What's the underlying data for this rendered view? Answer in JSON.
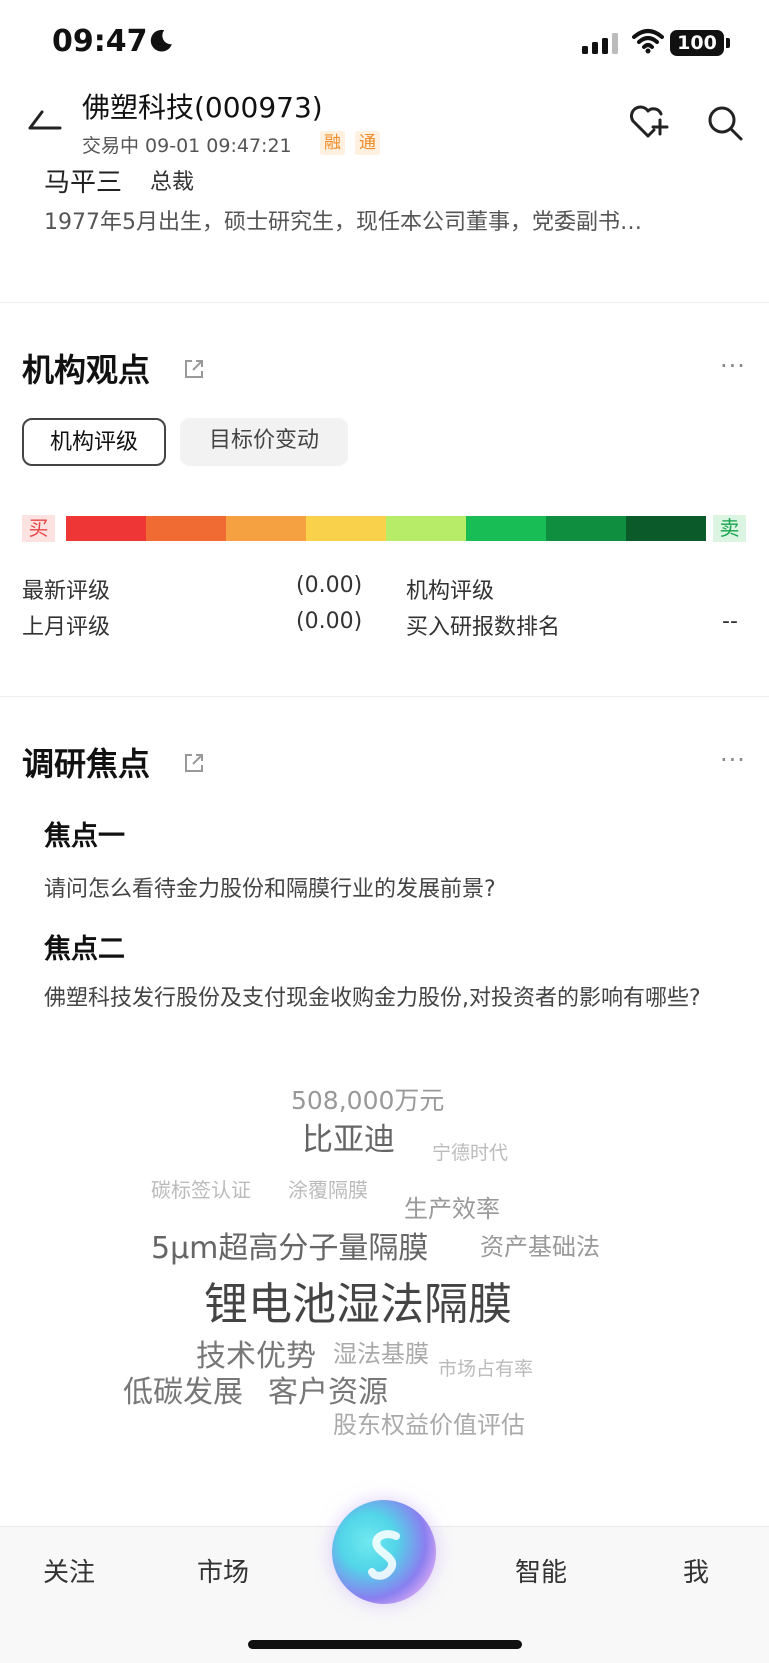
{
  "status_bar": {
    "time": "09:47",
    "battery": "100"
  },
  "header": {
    "title": "佛塑科技(000973)",
    "subtitle": "交易中  09-01 09:47:21",
    "tags": [
      "融",
      "通"
    ]
  },
  "executive": {
    "name": "马平三",
    "role": "总裁",
    "description": "1977年5月出生，硕士研究生，现任本公司董事，党委副书…"
  },
  "institution": {
    "title": "机构观点",
    "tabs": [
      "机构评级",
      "目标价变动"
    ],
    "buy_label": "买",
    "sell_label": "卖",
    "rating_colors": [
      "#ee3636",
      "#f06a34",
      "#f5a142",
      "#fad14a",
      "#b7ec68",
      "#19bd55",
      "#0e8e3e",
      "#0a5a2a"
    ],
    "stats": {
      "latest_label": "最新评级",
      "latest_value": "(0.00)",
      "last_month_label": "上月评级",
      "last_month_value": "(0.00)",
      "org_label": "机构评级",
      "rank_label": "买入研报数排名",
      "rank_value": "--"
    }
  },
  "research": {
    "title": "调研焦点",
    "focus": [
      {
        "heading": "焦点一",
        "question": "请问怎么看待金力股份和隔膜行业的发展前景?"
      },
      {
        "heading": "焦点二",
        "question": "佛塑科技发行股份及支付现金收购金力股份,对投资者的影响有哪些?"
      }
    ],
    "word_cloud": [
      "508,000万元",
      "比亚迪",
      "宁德时代",
      "碳标签认证",
      "涂覆隔膜",
      "生产效率",
      "5μm超高分子量隔膜",
      "资产基础法",
      "锂电池湿法隔膜",
      "技术优势",
      "湿法基膜",
      "市场占有率",
      "低碳发展",
      "客户资源",
      "股东权益价值评估"
    ]
  },
  "bottom_nav": {
    "items": [
      "关注",
      "市场",
      "智能",
      "我"
    ]
  }
}
